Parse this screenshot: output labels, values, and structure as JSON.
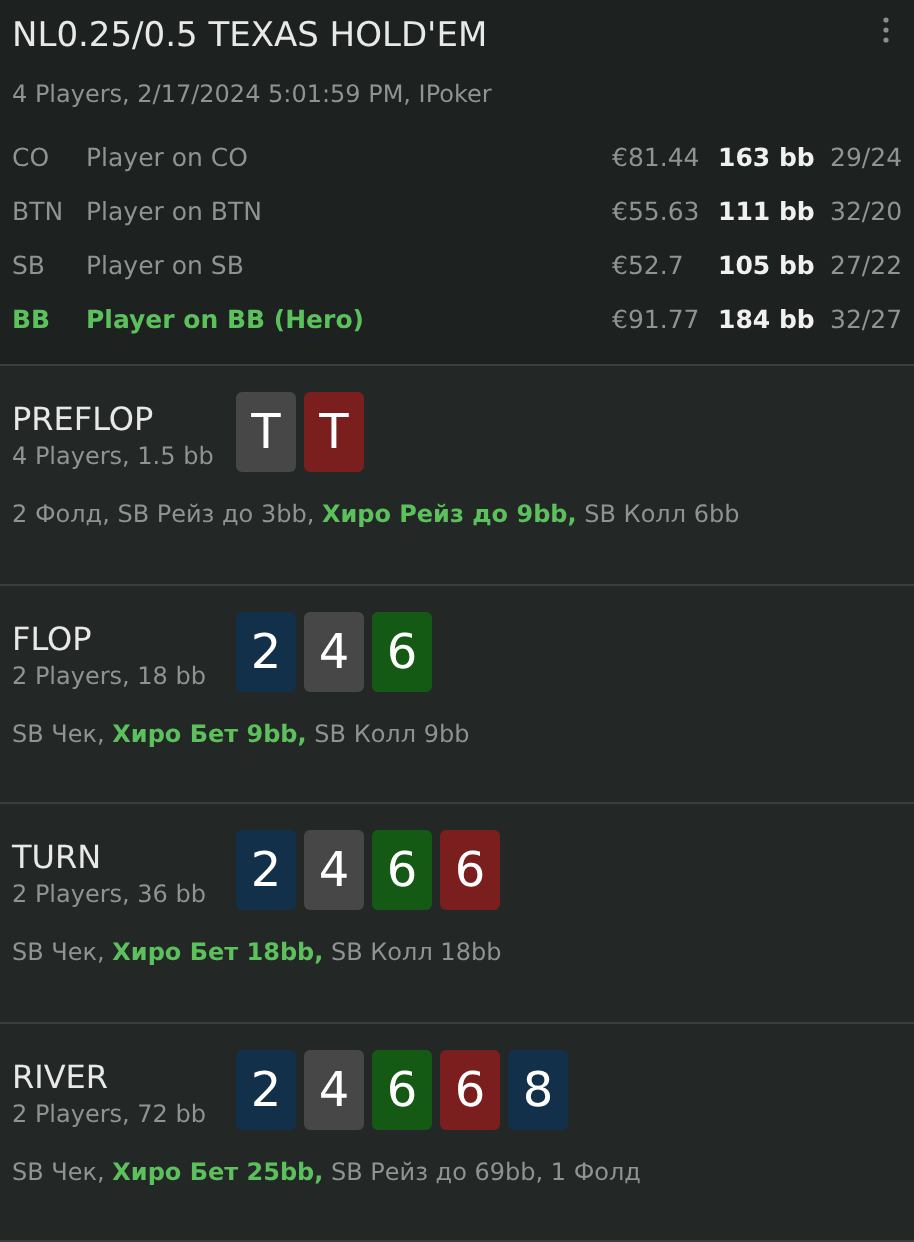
{
  "header": {
    "title": "NL0.25/0.5 TEXAS HOLD'EM",
    "subtitle": "4 Players, 2/17/2024 5:01:59 PM, IPoker"
  },
  "players": [
    {
      "position": "CO",
      "name": "Player on CO",
      "stack": "€81.44",
      "bb": "163 bb",
      "stats": "29/24",
      "hero": false
    },
    {
      "position": "BTN",
      "name": "Player on BTN",
      "stack": "€55.63",
      "bb": "111 bb",
      "stats": "32/20",
      "hero": false
    },
    {
      "position": "SB",
      "name": "Player on SB",
      "stack": "€52.7",
      "bb": "105 bb",
      "stats": "27/22",
      "hero": false
    },
    {
      "position": "BB",
      "name": "Player on BB (Hero)",
      "stack": "€91.77",
      "bb": "184 bb",
      "stats": "32/27",
      "hero": true
    }
  ],
  "streets": [
    {
      "name": "PREFLOP",
      "info": "4 Players, 1.5 bb",
      "cards": [
        {
          "rank": "T",
          "color": "#474747"
        },
        {
          "rank": "T",
          "color": "#7a1e1e"
        }
      ],
      "actions": "2 Фолд, SB Рейз до 3bb, **Хиро Рейз до 9bb,** SB Колл 6bb"
    },
    {
      "name": "FLOP",
      "info": "2 Players, 18 bb",
      "cards": [
        {
          "rank": "2",
          "color": "#13304a"
        },
        {
          "rank": "4",
          "color": "#474747"
        },
        {
          "rank": "6",
          "color": "#145a14"
        }
      ],
      "actions": "SB Чек, **Хиро Бет 9bb,** SB Колл 9bb"
    },
    {
      "name": "TURN",
      "info": "2 Players, 36 bb",
      "cards": [
        {
          "rank": "2",
          "color": "#13304a"
        },
        {
          "rank": "4",
          "color": "#474747"
        },
        {
          "rank": "6",
          "color": "#145a14"
        },
        {
          "rank": "6",
          "color": "#7a1e1e"
        }
      ],
      "actions": "SB Чек, **Хиро Бет 18bb,** SB Колл 18bb"
    },
    {
      "name": "RIVER",
      "info": "2 Players, 72 bb",
      "cards": [
        {
          "rank": "2",
          "color": "#13304a"
        },
        {
          "rank": "4",
          "color": "#474747"
        },
        {
          "rank": "6",
          "color": "#145a14"
        },
        {
          "rank": "6",
          "color": "#7a1e1e"
        },
        {
          "rank": "8",
          "color": "#13304a"
        }
      ],
      "actions": "SB Чек, **Хиро Бет 25bb,** SB Рейз до 69bb, 1 Фолд"
    }
  ]
}
